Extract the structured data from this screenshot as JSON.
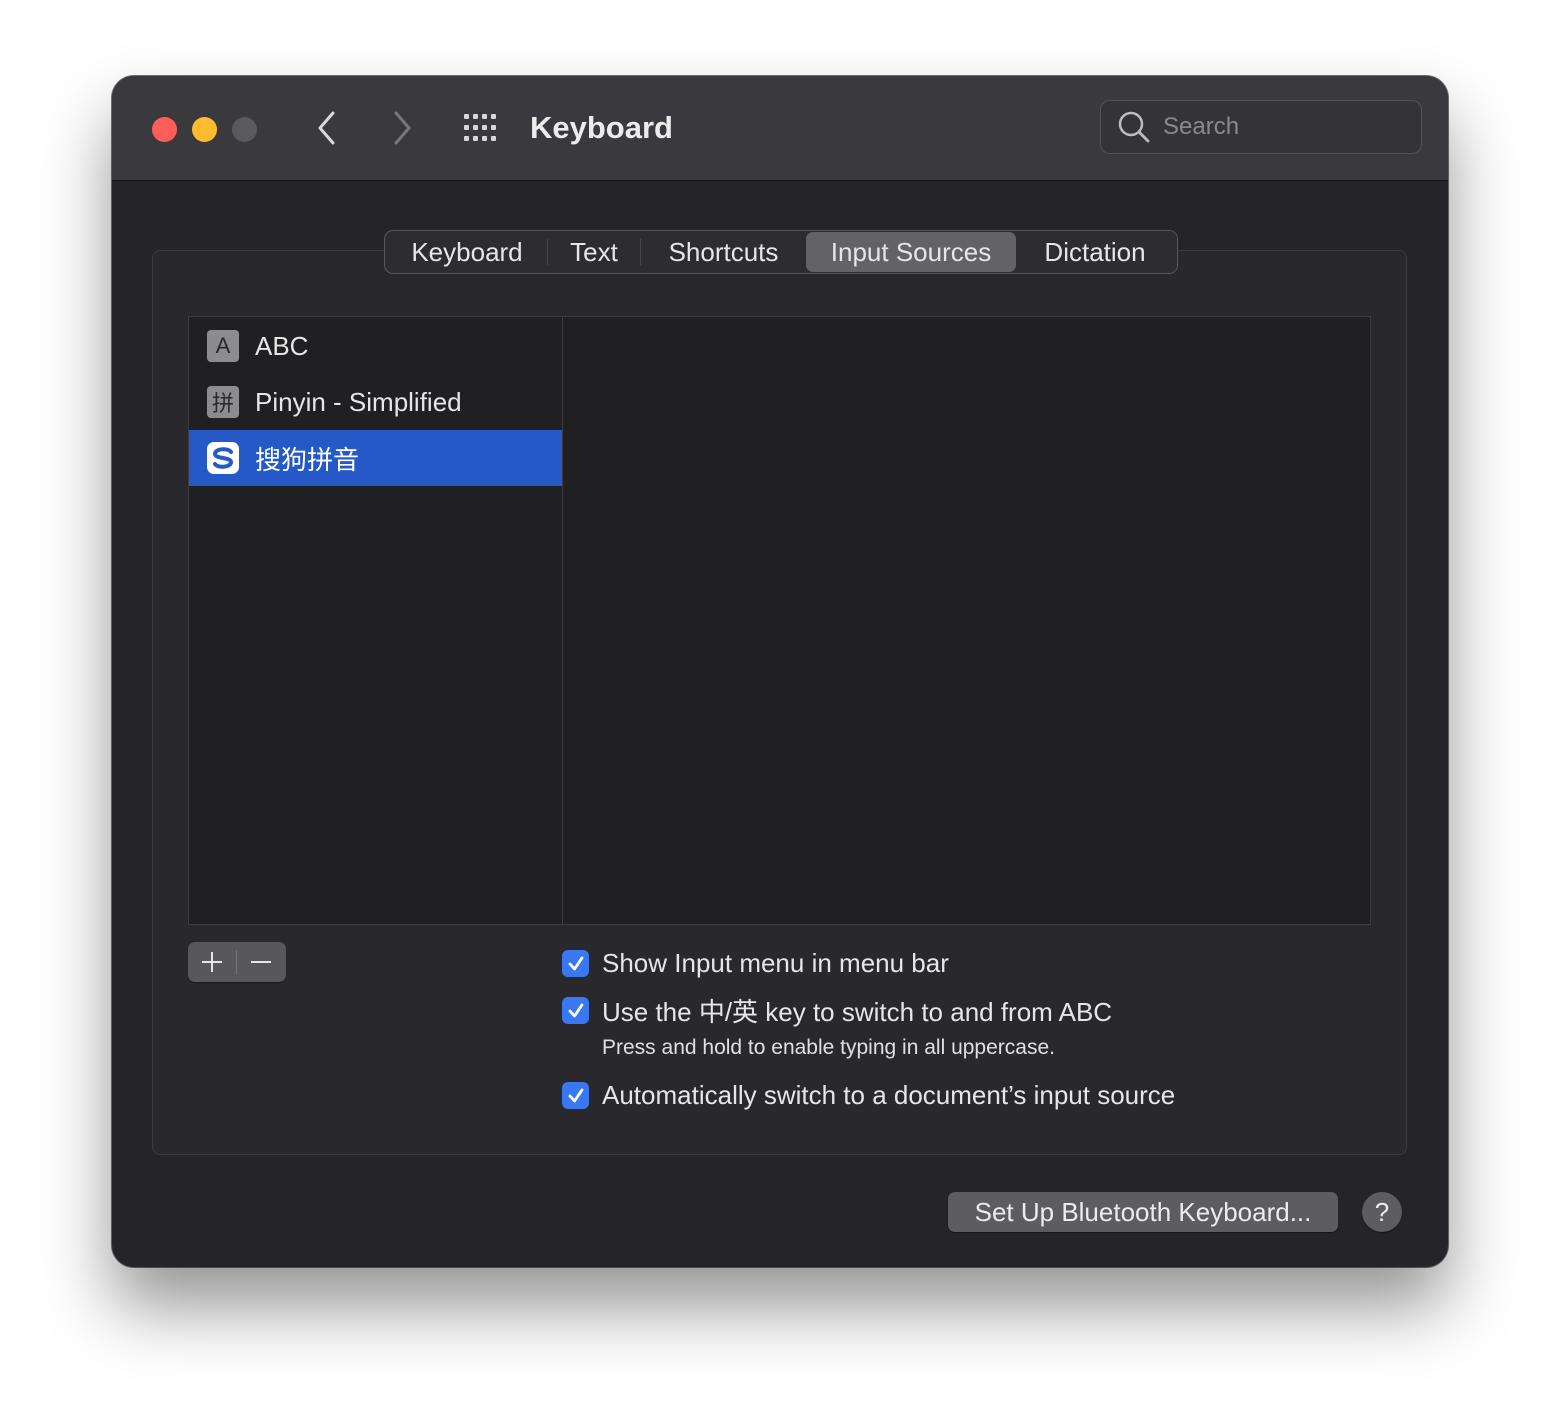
{
  "window": {
    "title": "Keyboard"
  },
  "search": {
    "placeholder": "Search"
  },
  "tabs": [
    "Keyboard",
    "Text",
    "Shortcuts",
    "Input Sources",
    "Dictation"
  ],
  "active_tab": "Input Sources",
  "input_sources": [
    {
      "label": "ABC",
      "icon": "abc-icon",
      "icon_text": "A",
      "selected": false
    },
    {
      "label": "Pinyin - Simplified",
      "icon": "pinyin-icon",
      "icon_text": "拼",
      "selected": false
    },
    {
      "label": "搜狗拼音",
      "icon": "sogou-icon",
      "selected": true
    }
  ],
  "list_controls": {
    "add": "+",
    "remove": "—"
  },
  "options": [
    {
      "label": "Show Input menu in menu bar",
      "checked": true
    },
    {
      "label": "Use the 中/英 key to switch to and from ABC",
      "checked": true,
      "note": "Press and hold to enable typing in all uppercase."
    },
    {
      "label": "Automatically switch to a document’s input source",
      "checked": true
    }
  ],
  "footer": {
    "bluetooth_button": "Set Up Bluetooth Keyboard...",
    "help_button": "?"
  },
  "colors": {
    "accent": "#3a78f2",
    "selection": "#2559c8",
    "close": "#ff5f57",
    "minimize": "#febc2e"
  }
}
